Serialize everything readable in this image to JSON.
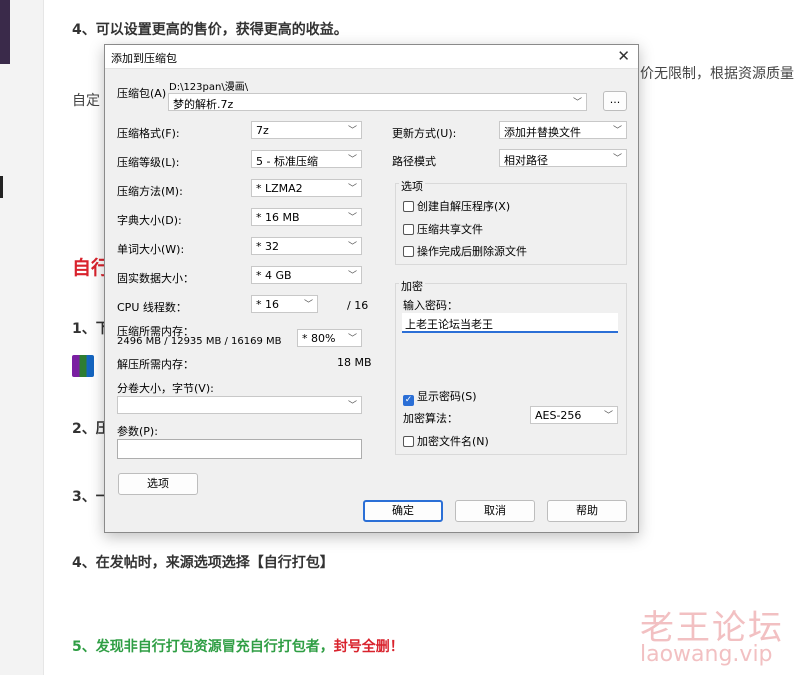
{
  "article": {
    "item4_top": "4、可以设置更高的售价，获得更高的收益。",
    "right_fragment": "售价无限制，根据资源质量",
    "left_fragment": "自定",
    "section_fragment": "自行",
    "step1_fragment": "1、下",
    "step2_fragment": "2、压",
    "step3_fragment": "3、一",
    "item4_bottom": "4、在发帖时，来源选项选择【自行打包】",
    "item5_main": "5、发现非自行打包资源冒充自行打包者，",
    "item5_red": "封号全删！",
    "watermark_cn": "老王论坛",
    "watermark_en": "laowang.vip"
  },
  "dialog": {
    "title": "添加到压缩包",
    "archive_label": "压缩包(A)",
    "archive_path": "D:\\123pan\\漫画\\",
    "archive_name": "梦的解析.7z",
    "browse_button": "...",
    "left": {
      "format_label": "压缩格式(F):",
      "format_value": "7z",
      "level_label": "压缩等级(L):",
      "level_value": "5 - 标准压缩",
      "method_label": "压缩方法(M):",
      "method_value": "* LZMA2",
      "dict_label": "字典大小(D):",
      "dict_value": "* 16 MB",
      "word_label": "单词大小(W):",
      "word_value": "* 32",
      "solid_label": "固实数据大小：",
      "solid_value": "* 4 GB",
      "cpu_label": "CPU 线程数：",
      "cpu_value": "* 16",
      "cpu_max": "/ 16",
      "mem_comp_label": "压缩所需内存：",
      "mem_comp_detail": "2496 MB / 12935 MB / 16169 MB",
      "mem_comp_value": "* 80%",
      "mem_decomp_label": "解压所需内存：",
      "mem_decomp_value": "18 MB",
      "volume_label": "分卷大小，字节(V):",
      "volume_value": "",
      "params_label": "参数(P):",
      "params_value": "",
      "options_button": "选项"
    },
    "right": {
      "update_label": "更新方式(U):",
      "update_value": "添加并替换文件",
      "path_label": "路径模式",
      "path_value": "相对路径",
      "options_group": "选项",
      "opt_sfx": "创建自解压程序(X)",
      "opt_shared": "压缩共享文件",
      "opt_delete": "操作完成后删除源文件",
      "encrypt_group": "加密",
      "password_label": "输入密码：",
      "password_value": "上老王论坛当老王",
      "show_password": "显示密码(S)",
      "algo_label": "加密算法：",
      "algo_value": "AES-256",
      "encrypt_names": "加密文件名(N)"
    },
    "buttons": {
      "ok": "确定",
      "cancel": "取消",
      "help": "帮助"
    }
  }
}
